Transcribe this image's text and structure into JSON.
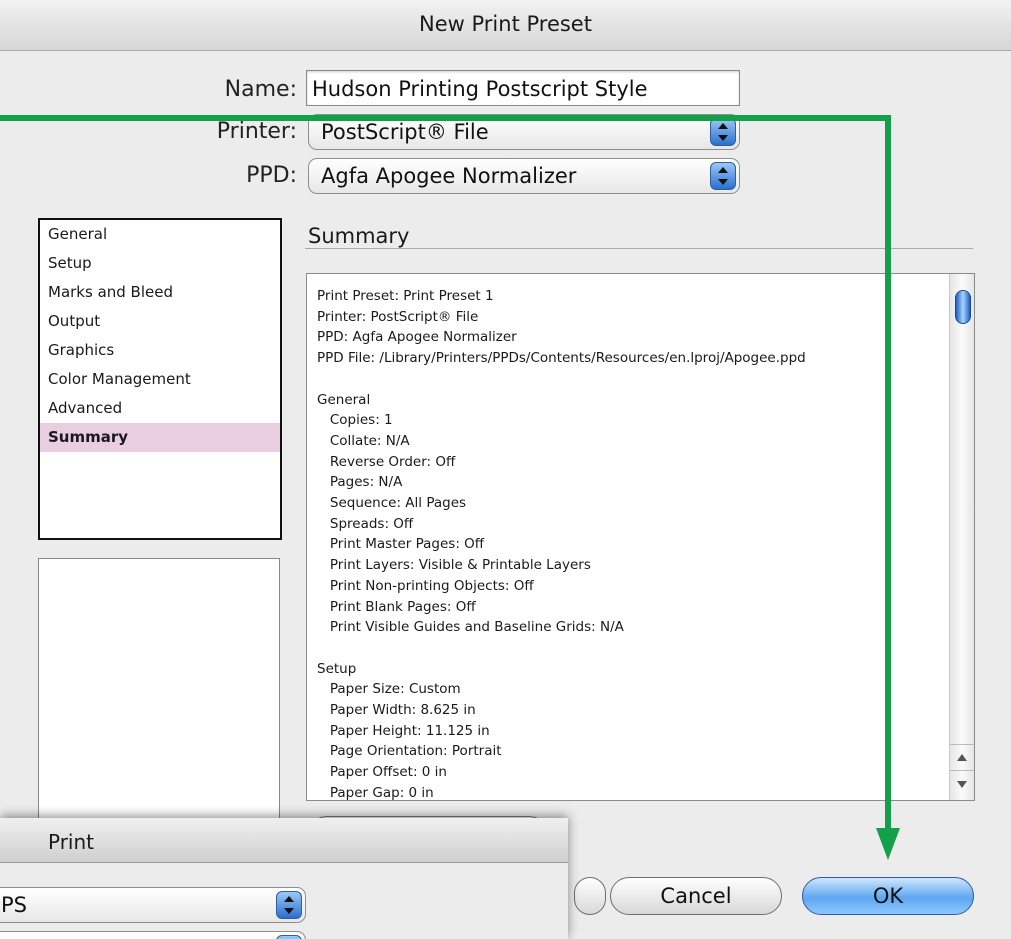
{
  "dialog": {
    "title": "New Print Preset",
    "name_label": "Name:",
    "name_value": "Hudson Printing Postscript Style",
    "printer_label": "Printer:",
    "printer_value": "PostScript® File",
    "ppd_label": "PPD:",
    "ppd_value": "Agfa Apogee Normalizer"
  },
  "categories": [
    "General",
    "Setup",
    "Marks and Bleed",
    "Output",
    "Graphics",
    "Color Management",
    "Advanced",
    "Summary"
  ],
  "selected_category": "Summary",
  "summary": {
    "heading": "Summary",
    "lines": [
      "Print Preset: Print Preset 1",
      "Printer: PostScript® File",
      "PPD: Agfa Apogee Normalizer",
      "PPD File: /Library/Printers/PPDs/Contents/Resources/en.lproj/Apogee.ppd",
      "",
      "General",
      "   Copies: 1",
      "   Collate: N/A",
      "   Reverse Order: Off",
      "   Pages: N/A",
      "   Sequence: All Pages",
      "   Spreads: Off",
      "   Print Master Pages: Off",
      "   Print Layers: Visible & Printable Layers",
      "   Print Non-printing Objects: Off",
      "   Print Blank Pages: Off",
      "   Print Visible Guides and Baseline Grids: N/A",
      "",
      "Setup",
      "   Paper Size: Custom",
      "   Paper Width: 8.625 in",
      "   Paper Height: 11.125 in",
      "   Page Orientation: Portrait",
      "   Paper Offset: 0 in",
      "   Paper Gap: 0 in"
    ]
  },
  "buttons": {
    "cancel": "Cancel",
    "ok": "OK"
  },
  "print_window": {
    "title": "Print",
    "popup1_value": "PS"
  },
  "colors": {
    "arrow": "#12a04a",
    "selection": "#e9cde1",
    "ok_button": "#5ea7f0"
  }
}
